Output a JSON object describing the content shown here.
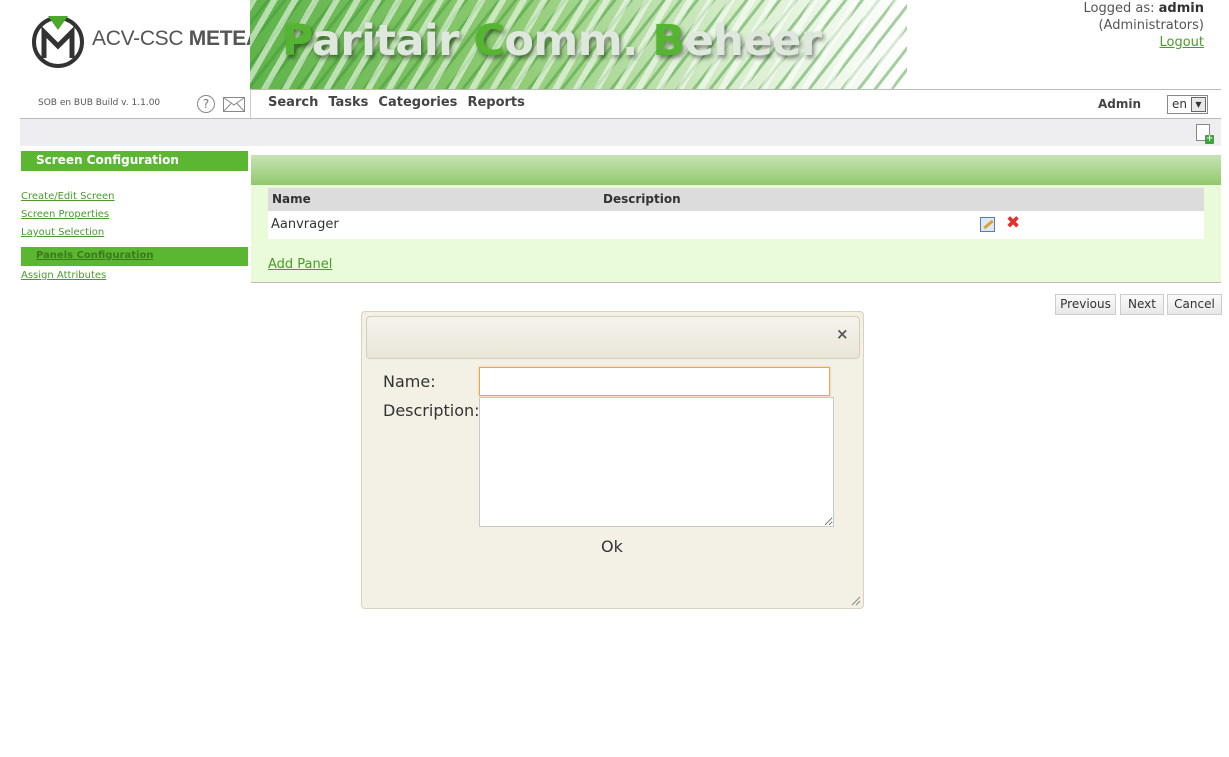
{
  "logo": {
    "brand_light": "ACV-CSC ",
    "brand_bold": "METEA"
  },
  "banner": {
    "parts": [
      {
        "cap": "P",
        "rest": "aritair "
      },
      {
        "cap": "C",
        "rest": "omm. "
      },
      {
        "cap": "B",
        "rest": "eheer"
      }
    ]
  },
  "user": {
    "logged_as_label": "Logged as: ",
    "username": "admin",
    "role": "(Administrators)",
    "logout": "Logout"
  },
  "build": "SOB en BUB Build v. 1.1.00",
  "help_glyph": "?",
  "nav": {
    "items": [
      "Search",
      "Tasks",
      "Categories",
      "Reports"
    ],
    "user_label": "Admin",
    "language": "en"
  },
  "sidebar": {
    "title": "Screen Configuration",
    "links": [
      {
        "label": "Create/Edit Screen"
      },
      {
        "label": "Screen Properties"
      },
      {
        "label": "Layout Selection"
      },
      {
        "label": "Panels Configuration",
        "active": true
      },
      {
        "label": "Assign Attributes"
      }
    ]
  },
  "table": {
    "headers": [
      "Name",
      "Description"
    ],
    "rows": [
      {
        "name": "Aanvrager",
        "description": ""
      }
    ]
  },
  "add_panel": "Add Panel",
  "buttons": {
    "previous": "Previous",
    "next": "Next",
    "cancel": "Cancel"
  },
  "dialog": {
    "close_glyph": "×",
    "name_label": "Name:",
    "name_value": "",
    "description_label": "Description:",
    "description_value": "",
    "ok": "Ok"
  },
  "colors": {
    "accent": "#5bb732",
    "link": "#4a9a2e",
    "panel_bg": "#e9fbd9",
    "dialog_bg": "#f3f0e5"
  }
}
